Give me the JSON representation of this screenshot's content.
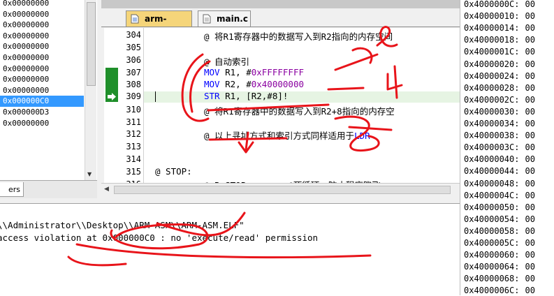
{
  "registers": {
    "values": [
      "0x00000000",
      "0x00000000",
      "0x00000000",
      "0x00000000",
      "0x00000000",
      "0x00000000",
      "0x00000000",
      "0x00000000",
      "0x00000000",
      "0x000000C0",
      "0x000000D3",
      "0x00000000"
    ],
    "selected_index": 9
  },
  "left_tab": {
    "label": "ers"
  },
  "editor": {
    "tabs": [
      {
        "label": "arm-asm.s",
        "active": true
      },
      {
        "label": "main.c",
        "active": false
      }
    ],
    "lines": [
      {
        "num": "304",
        "text": "@ 将R1寄存器中的数据写入到R2指向的内存空间"
      },
      {
        "num": "305",
        "text": ""
      },
      {
        "num": "306",
        "text": "@ 自动索引"
      },
      {
        "num": "307",
        "kw": "MOV",
        "arg1": " R1, #",
        "hex": "0xFFFFFFFF"
      },
      {
        "num": "308",
        "kw": "MOV",
        "arg1": " R2, #",
        "hex": "0x40000000"
      },
      {
        "num": "309",
        "kw": "STR",
        "arg1": " R1, [R2,#8]!"
      },
      {
        "num": "310",
        "text": "@ 将R1寄存器中的数据写入到R2+8指向的内存空"
      },
      {
        "num": "311",
        "text": ""
      },
      {
        "num": "312",
        "text": "@ 以上寻址方式和索引方式同样适用于",
        "tail": "LDR"
      },
      {
        "num": "313",
        "text": ""
      },
      {
        "num": "314",
        "text": ""
      },
      {
        "num": "315",
        "text": "@ STOP:"
      },
      {
        "num": "316",
        "text": "@ B STOP        @死循环，防止程序跑飞"
      }
    ]
  },
  "memory": {
    "addresses": [
      "0x4000000C:",
      "0x40000010:",
      "0x40000014:",
      "0x40000018:",
      "0x4000001C:",
      "0x40000020:",
      "0x40000024:",
      "0x40000028:",
      "0x4000002C:",
      "0x40000030:",
      "0x40000034:",
      "0x40000038:",
      "0x4000003C:",
      "0x40000040:",
      "0x40000044:",
      "0x40000048:",
      "0x4000004C:",
      "0x40000050:",
      "0x40000054:",
      "0x40000058:",
      "0x4000005C:",
      "0x40000060:",
      "0x40000064:",
      "0x40000068:",
      "0x4000006C:"
    ],
    "values": [
      "00",
      "00",
      "00",
      "00",
      "00",
      "00",
      "00",
      "00",
      "00",
      "00",
      "00",
      "00",
      "00",
      "00",
      "00",
      "00",
      "00",
      "00",
      "00",
      "00",
      "00",
      "00",
      "00",
      "00",
      "00"
    ]
  },
  "output": {
    "lines": [
      "\\\\Administrator\\\\Desktop\\\\ARM-ASM\\\\ARM-ASM.ELF\"",
      "access violation at 0x000000C0 : no 'execute/read' permission"
    ]
  },
  "colors": {
    "selection": "#3399ff",
    "breakpoint_green": "#1f8f2a",
    "active_tab": "#f5d57a",
    "annotation_red": "#e8141a",
    "keyword_blue": "#0000ff",
    "hex_purple": "#8a00a0"
  }
}
